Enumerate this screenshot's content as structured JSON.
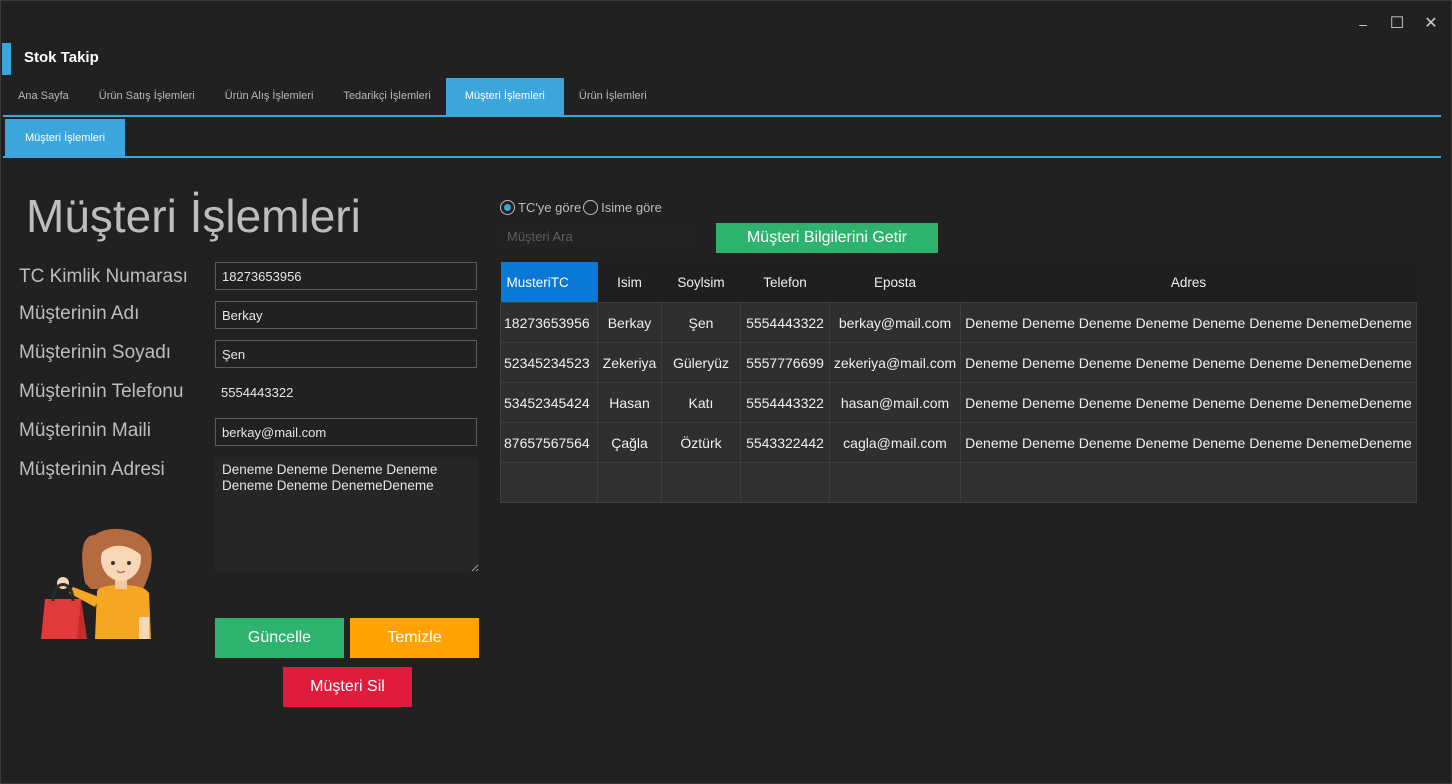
{
  "app": {
    "title": "Stok Takip"
  },
  "window_controls": {
    "minimize": "–",
    "maximize": "☐",
    "close": "✕"
  },
  "tabs": [
    {
      "label": "Ana Sayfa",
      "active": false
    },
    {
      "label": "Ürün Satış İşlemleri",
      "active": false
    },
    {
      "label": "Ürün Alış İşlemleri",
      "active": false
    },
    {
      "label": "Tedarikçi İşlemleri",
      "active": false
    },
    {
      "label": "Müşteri İşlemleri",
      "active": true
    },
    {
      "label": "Ürün İşlemleri",
      "active": false
    }
  ],
  "subtab": {
    "label": "Müşteri İşlemleri"
  },
  "form": {
    "heading": "Müşteri İşlemleri",
    "tc_label": "TC Kimlik Numarası",
    "tc_value": "18273653956",
    "name_label": "Müşterinin Adı",
    "name_value": "Berkay",
    "surname_label": "Müşterinin Soyadı",
    "surname_value": "Şen",
    "phone_label": "Müşterinin Telefonu",
    "phone_value": "5554443322",
    "mail_label": "Müşterinin Maili",
    "mail_value": "berkay@mail.com",
    "address_label": "Müşterinin Adresi",
    "address_value": "Deneme Deneme Deneme Deneme\nDeneme Deneme DenemeDeneme",
    "update_button": "Güncelle",
    "clear_button": "Temizle",
    "delete_button": "Müşteri Sil"
  },
  "search": {
    "radio_tc": "TC'ye göre",
    "radio_name": "Isime göre",
    "radio_selected": "tc",
    "placeholder": "Müşteri Ara",
    "fetch_button": "Müşteri Bilgilerini Getir"
  },
  "table": {
    "columns": [
      "MusteriTC",
      "Isim",
      "Soylsim",
      "Telefon",
      "Eposta",
      "Adres"
    ],
    "rows": [
      [
        "18273653956",
        "Berkay",
        "Şen",
        "5554443322",
        "berkay@mail.com",
        "Deneme Deneme Deneme Deneme Deneme Deneme DenemeDeneme"
      ],
      [
        "52345234523",
        "Zekeriya",
        "Güleryüz",
        "5557776699",
        "zekeriya@mail.com",
        "Deneme Deneme Deneme Deneme Deneme Deneme DenemeDeneme"
      ],
      [
        "53452345424",
        "Hasan",
        "Katı",
        "5554443322",
        "hasan@mail.com",
        "Deneme Deneme Deneme Deneme Deneme Deneme DenemeDeneme"
      ],
      [
        "87657567564",
        "Çağla",
        "Öztürk",
        "5543322442",
        "cagla@mail.com",
        "Deneme Deneme Deneme Deneme Deneme Deneme DenemeDeneme"
      ]
    ]
  },
  "colors": {
    "accent": "#3aa6dc",
    "green": "#2db36d",
    "orange": "#ffa305",
    "red": "#e01c3c",
    "selected_header": "#0a78d6",
    "background": "#212121"
  }
}
